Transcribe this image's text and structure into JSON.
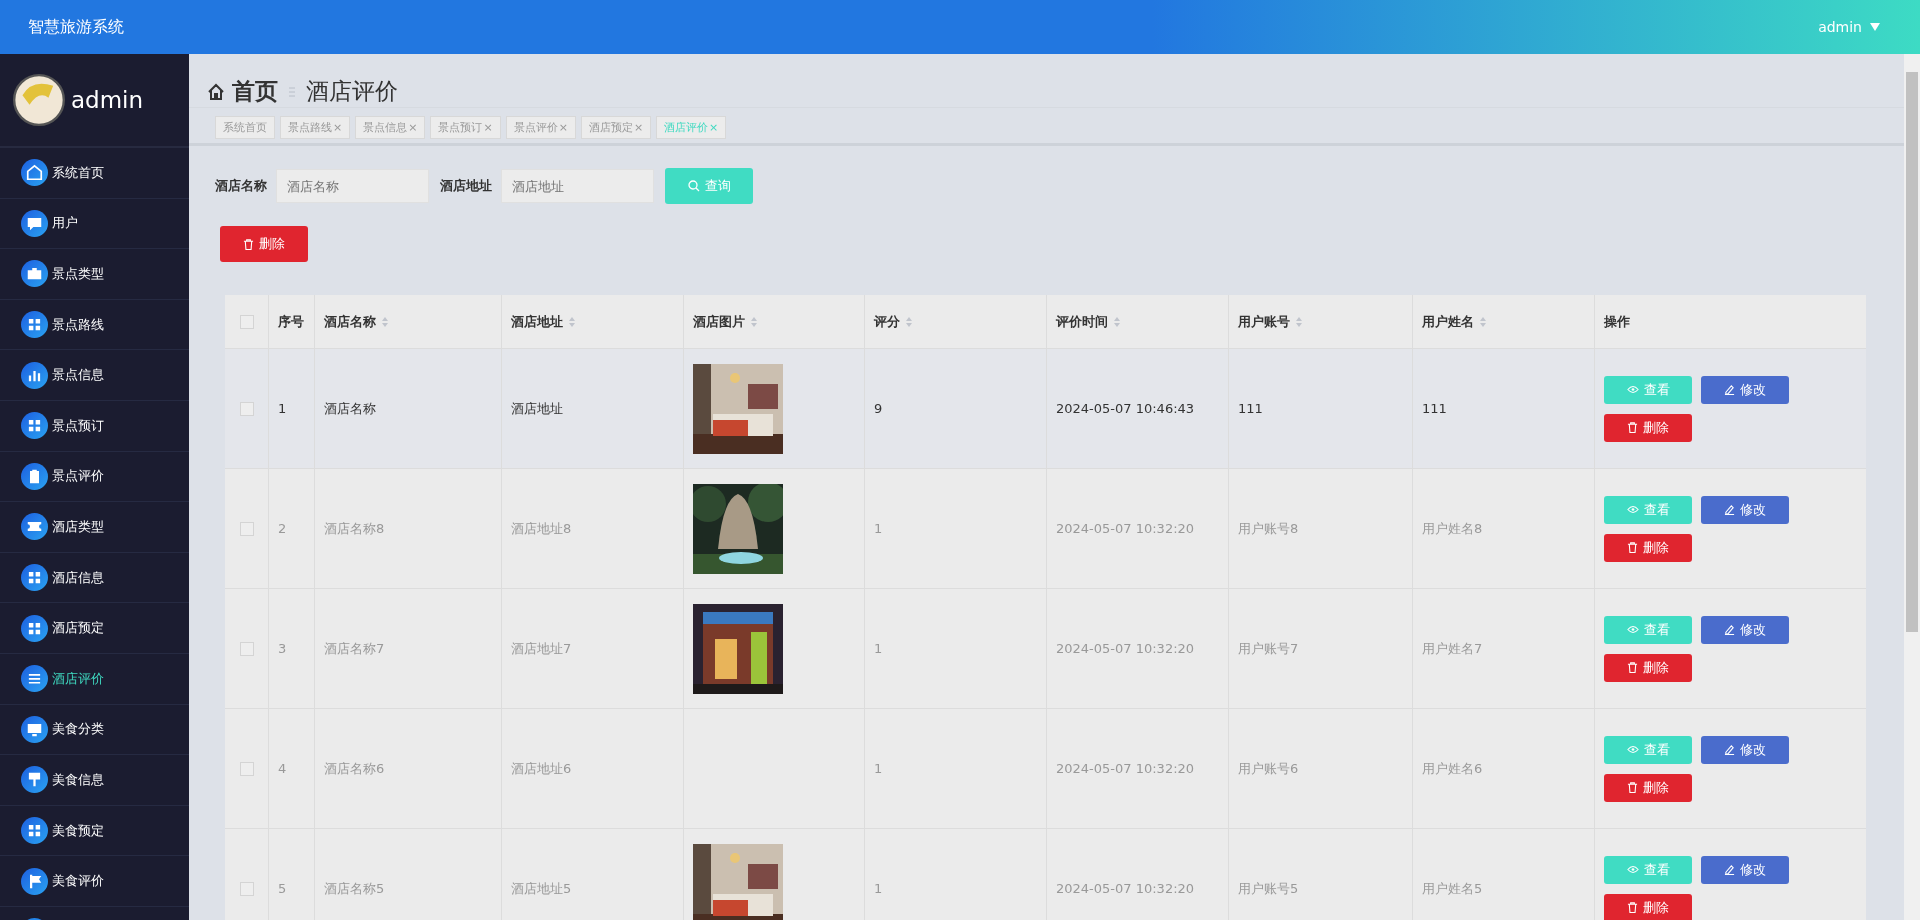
{
  "header": {
    "title": "智慧旅游系统",
    "user": "admin"
  },
  "sidebar": {
    "user": "admin",
    "items": [
      {
        "label": "系统首页",
        "selected": false
      },
      {
        "label": "用户",
        "selected": false
      },
      {
        "label": "景点类型",
        "selected": false
      },
      {
        "label": "景点路线",
        "selected": false
      },
      {
        "label": "景点信息",
        "selected": false
      },
      {
        "label": "景点预订",
        "selected": false
      },
      {
        "label": "景点评价",
        "selected": false
      },
      {
        "label": "酒店类型",
        "selected": false
      },
      {
        "label": "酒店信息",
        "selected": false
      },
      {
        "label": "酒店预定",
        "selected": false
      },
      {
        "label": "酒店评价",
        "selected": true
      },
      {
        "label": "美食分类",
        "selected": false
      },
      {
        "label": "美食信息",
        "selected": false
      },
      {
        "label": "美食预定",
        "selected": false
      },
      {
        "label": "美食评价",
        "selected": false
      }
    ]
  },
  "breadcrumb": {
    "home": "首页",
    "current": "酒店评价"
  },
  "tabs": [
    {
      "label": "系统首页",
      "selected": false
    },
    {
      "label": "景点路线",
      "close": "×",
      "selected": false
    },
    {
      "label": "景点信息",
      "close": "×",
      "selected": false
    },
    {
      "label": "景点预订",
      "close": "×",
      "selected": false
    },
    {
      "label": "景点评价",
      "close": "×",
      "selected": false
    },
    {
      "label": "酒店预定",
      "close": "×",
      "selected": false
    },
    {
      "label": "酒店评价",
      "close": "×",
      "selected": true
    }
  ],
  "search": {
    "fields": [
      {
        "label": "酒店名称",
        "placeholder": "酒店名称"
      },
      {
        "label": "酒店地址",
        "placeholder": "酒店地址"
      }
    ],
    "button": "查询"
  },
  "delete_button": "删除",
  "table": {
    "header_checked": false,
    "columns": [
      {
        "label": "序号",
        "sortable": false
      },
      {
        "label": "酒店名称",
        "sortable": true
      },
      {
        "label": "酒店地址",
        "sortable": true
      },
      {
        "label": "酒店图片",
        "sortable": true
      },
      {
        "label": "评分",
        "sortable": true
      },
      {
        "label": "评价时间",
        "sortable": true
      },
      {
        "label": "用户账号",
        "sortable": true
      },
      {
        "label": "用户姓名",
        "sortable": true
      },
      {
        "label": "操作",
        "sortable": false
      }
    ],
    "rows": [
      {
        "checked": false,
        "hovered": true,
        "cells": [
          "1",
          "酒店名称",
          "酒店地址",
          "",
          "9",
          "2024-05-07 10:46:43",
          "111",
          "111"
        ],
        "image": {
          "kind": "picture"
        },
        "actions": [
          {
            "kind": "view",
            "label": "查看"
          },
          {
            "kind": "edit",
            "label": "修改"
          },
          {
            "kind": "delete",
            "label": "删除"
          }
        ]
      },
      {
        "checked": false,
        "hovered": false,
        "cells": [
          "2",
          "酒店名称8",
          "酒店地址8",
          "",
          "1",
          "2024-05-07 10:32:20",
          "用户账号8",
          "用户姓名8"
        ],
        "image": {
          "kind": "picture"
        },
        "actions": [
          {
            "kind": "view",
            "label": "查看"
          },
          {
            "kind": "edit",
            "label": "修改"
          },
          {
            "kind": "delete",
            "label": "删除"
          }
        ]
      },
      {
        "checked": false,
        "hovered": false,
        "cells": [
          "3",
          "酒店名称7",
          "酒店地址7",
          "",
          "1",
          "2024-05-07 10:32:20",
          "用户账号7",
          "用户姓名7"
        ],
        "image": {
          "kind": "picture"
        },
        "actions": [
          {
            "kind": "view",
            "label": "查看"
          },
          {
            "kind": "edit",
            "label": "修改"
          },
          {
            "kind": "delete",
            "label": "删除"
          }
        ]
      },
      {
        "checked": false,
        "hovered": false,
        "cells": [
          "4",
          "酒店名称6",
          "酒店地址6",
          "",
          "1",
          "2024-05-07 10:32:20",
          "用户账号6",
          "用户姓名6"
        ],
        "actions": [
          {
            "kind": "view",
            "label": "查看"
          },
          {
            "kind": "edit",
            "label": "修改"
          },
          {
            "kind": "delete",
            "label": "删除"
          }
        ]
      },
      {
        "checked": false,
        "hovered": false,
        "cells": [
          "5",
          "酒店名称5",
          "酒店地址5",
          "",
          "1",
          "2024-05-07 10:32:20",
          "用户账号5",
          "用户姓名5"
        ],
        "image": {
          "kind": "picture"
        },
        "actions": [
          {
            "kind": "view",
            "label": "查看"
          },
          {
            "kind": "edit",
            "label": "修改"
          },
          {
            "kind": "delete",
            "label": "删除"
          }
        ]
      }
    ]
  }
}
